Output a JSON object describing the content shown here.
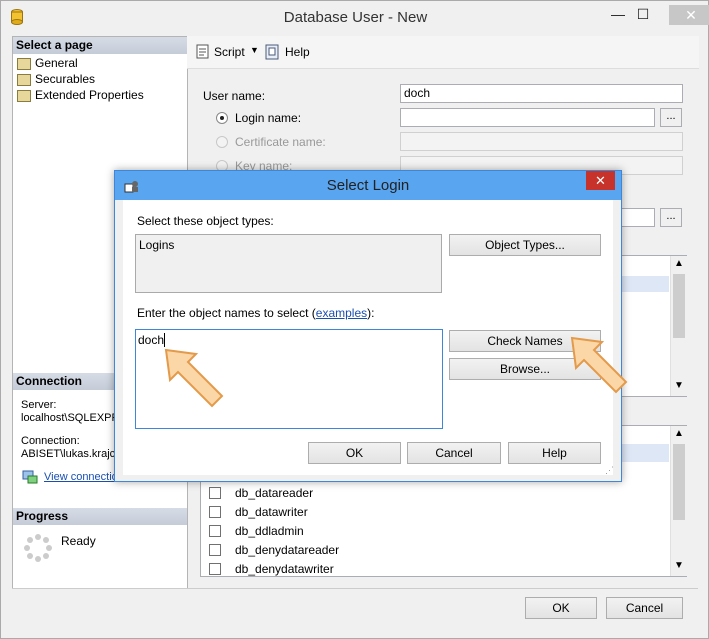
{
  "window": {
    "title": "Database User - New",
    "minimize_glyph": "—",
    "maximize_glyph": "☐",
    "close_glyph": "✕"
  },
  "left_panel": {
    "select_page_header": "Select a page",
    "pages": [
      "General",
      "Securables",
      "Extended Properties"
    ],
    "connection_header": "Connection",
    "server_label": "Server:",
    "server_value": "localhost\\SQLEXPR",
    "connection_label": "Connection:",
    "connection_value": "ABISET\\lukas.krajc",
    "view_connection_link": "View connectio",
    "progress_header": "Progress",
    "progress_status": "Ready"
  },
  "toolbar": {
    "script_label": "Script",
    "help_label": "Help"
  },
  "form": {
    "user_name_label": "User name:",
    "user_name_value": "doch",
    "login_name_label": "Login name:",
    "login_name_value": "",
    "certificate_name_label": "Certificate name:",
    "key_name_label": "Key name:",
    "browse_glyph": "..."
  },
  "role_list": {
    "items": [
      "db_datareader",
      "db_datawriter",
      "db_ddladmin",
      "db_denydatareader",
      "db_denydatawriter"
    ]
  },
  "footer": {
    "ok_label": "OK",
    "cancel_label": "Cancel"
  },
  "dialog": {
    "title": "Select Login",
    "close_glyph": "✕",
    "object_types_label": "Select these object types:",
    "object_types_value": "Logins",
    "object_types_button": "Object Types...",
    "enter_names_prefix": "Enter the object names to select (",
    "examples_link": "examples",
    "enter_names_suffix": "):",
    "names_value": "doch",
    "check_names_button": "Check Names",
    "browse_button": "Browse...",
    "ok_button": "OK",
    "cancel_button": "Cancel",
    "help_button": "Help"
  }
}
